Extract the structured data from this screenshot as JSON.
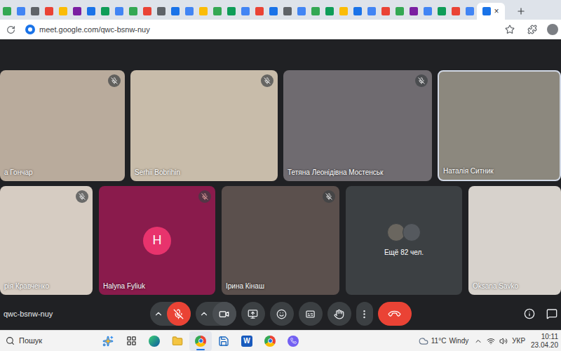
{
  "browser": {
    "tabs": [
      {
        "color": "#34a853",
        "selected": false
      },
      {
        "color": "#4285f4",
        "selected": false
      },
      {
        "color": "#5f6368",
        "selected": false
      },
      {
        "color": "#ea4335",
        "selected": false
      },
      {
        "color": "#fbbc05",
        "selected": false
      },
      {
        "color": "#7b1fa2",
        "selected": false
      },
      {
        "color": "#1a73e8",
        "selected": false
      },
      {
        "color": "#0f9d58",
        "selected": false
      },
      {
        "color": "#4285f4",
        "selected": false
      },
      {
        "color": "#34a853",
        "selected": false
      },
      {
        "color": "#ea4335",
        "selected": false
      },
      {
        "color": "#5f6368",
        "selected": false
      },
      {
        "color": "#1a73e8",
        "selected": false
      },
      {
        "color": "#4285f4",
        "selected": false
      },
      {
        "color": "#fbbc05",
        "selected": false
      },
      {
        "color": "#34a853",
        "selected": false
      },
      {
        "color": "#0f9d58",
        "selected": false
      },
      {
        "color": "#4285f4",
        "selected": false
      },
      {
        "color": "#ea4335",
        "selected": false
      },
      {
        "color": "#1a73e8",
        "selected": false
      },
      {
        "color": "#5f6368",
        "selected": false
      },
      {
        "color": "#4285f4",
        "selected": false
      },
      {
        "color": "#34a853",
        "selected": false
      },
      {
        "color": "#0f9d58",
        "selected": false
      },
      {
        "color": "#fbbc05",
        "selected": false
      },
      {
        "color": "#1a73e8",
        "selected": false
      },
      {
        "color": "#4285f4",
        "selected": false
      },
      {
        "color": "#ea4335",
        "selected": false
      },
      {
        "color": "#34a853",
        "selected": false
      },
      {
        "color": "#7b1fa2",
        "selected": false
      },
      {
        "color": "#4285f4",
        "selected": false
      },
      {
        "color": "#0f9d58",
        "selected": false
      },
      {
        "color": "#ea4335",
        "selected": false
      },
      {
        "color": "#4285f4",
        "selected": false
      },
      {
        "color": "#1a73e8",
        "selected": true
      }
    ],
    "close": "×",
    "url": "meet.google.com/qwc-bsnw-nuy"
  },
  "meeting": {
    "code": "qwc-bsnw-nuy",
    "rows": [
      [
        {
          "name": "а Гончар",
          "kind": "video",
          "muted": true,
          "speaking": false,
          "color": "#b9ab9c"
        },
        {
          "name": "Serhii Bobrihin",
          "kind": "video",
          "muted": true,
          "speaking": false,
          "color": "#c8bcaa"
        },
        {
          "name": "Тетяна Леонідівна Мостенськ",
          "kind": "video",
          "muted": true,
          "speaking": false,
          "color": "#6f6b70"
        },
        {
          "name": "Наталія Ситник",
          "kind": "video",
          "muted": false,
          "speaking": true,
          "color": "#8c887e"
        }
      ],
      [
        {
          "name": "рія Кравченко",
          "kind": "video",
          "muted": true,
          "speaking": false,
          "color": "#d6ccc2"
        },
        {
          "name": "Halyna Fyliuk",
          "kind": "avatar",
          "avatar": "H",
          "muted": true,
          "speaking": false,
          "color": "#8a1b4c"
        },
        {
          "name": "Ірина Кінаш",
          "kind": "video",
          "muted": true,
          "speaking": false,
          "color": "#5b504d"
        },
        {
          "name": "Ещё 82 чел.",
          "kind": "more",
          "muted": false,
          "speaking": false,
          "color": "#3c4043"
        },
        {
          "name": "Oksana Savko",
          "kind": "video",
          "muted": false,
          "speaking": false,
          "color": "#d7d2cc"
        }
      ]
    ],
    "controls": [
      {
        "kind": "mic",
        "on": false
      },
      {
        "kind": "camera",
        "on": true
      },
      {
        "kind": "present",
        "on": false
      },
      {
        "kind": "emoji",
        "on": false
      },
      {
        "kind": "captions",
        "on": false
      },
      {
        "kind": "hand",
        "on": false
      },
      {
        "kind": "more",
        "on": false
      },
      {
        "kind": "leave",
        "on": false
      }
    ]
  },
  "taskbar": {
    "search": "Пошук",
    "apps": [
      {
        "kind": "copilot",
        "active": false
      },
      {
        "kind": "taskview",
        "active": false
      },
      {
        "kind": "edge",
        "active": false
      },
      {
        "kind": "explorer",
        "active": false
      },
      {
        "kind": "chrome",
        "active": true
      },
      {
        "kind": "save",
        "active": false
      },
      {
        "kind": "word",
        "label": "W",
        "active": false
      },
      {
        "kind": "chrome",
        "active": false
      },
      {
        "kind": "viber",
        "active": false
      }
    ],
    "weather": {
      "temp": "11°C",
      "text": "Windy"
    },
    "language": "УКР",
    "time": "10:11",
    "date": "23.04.20"
  }
}
